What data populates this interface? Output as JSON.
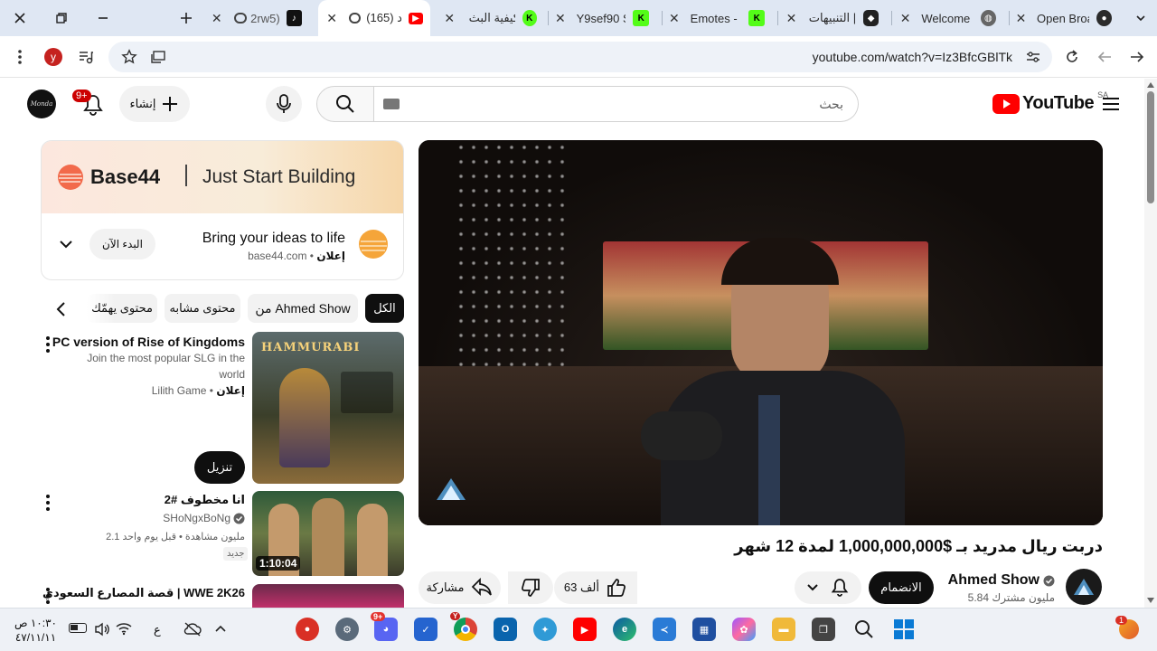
{
  "tabs": [
    {
      "title": "2rw5)",
      "favicon": "tiktok-icon"
    },
    {
      "title": "(165) ‏ د",
      "favicon": "youtube-icon",
      "active": true
    },
    {
      "title": "كيفية البث",
      "favicon": "kick-icon"
    },
    {
      "title": "Y9sef90 St",
      "favicon": "kick-icon"
    },
    {
      "title": "Emotes - K",
      "favicon": "kick-icon"
    },
    {
      "title": "التنبيهات |",
      "favicon": "streamelements-icon"
    },
    {
      "title": "Welcome",
      "favicon": "globe-icon"
    },
    {
      "title": "Open Broa",
      "favicon": "obs-icon"
    }
  ],
  "toolbar": {
    "url": "youtube.com/watch?v=Iz3BfcGBlTk",
    "profile_initial": "y"
  },
  "header": {
    "logo_text": "YouTube",
    "region": "SA",
    "search_placeholder": "بحث",
    "create_label": "إنشاء",
    "notifications_badge": "9+"
  },
  "ad": {
    "banner_brand": "Base44",
    "banner_tagline": "Just Start Building",
    "headline": "Bring your ideas to life",
    "sponsored_label": "إعلان",
    "domain": "base44.com",
    "cta": "البدء الآن"
  },
  "chips": [
    "الكل",
    "من Ahmed Show",
    "محتوى مشابه",
    "محتوى يهمّك"
  ],
  "recommendations": [
    {
      "title": "PC version of Rise of Kingdoms",
      "desc_line1": "Join the most popular SLG in the",
      "desc_line2": "world",
      "sponsored_label": "إعلان",
      "channel": "Lilith Game",
      "install_label": "تنزيل",
      "thumb_title": "HAMMURABI"
    },
    {
      "title": "انا مخطوف #2",
      "channel": "SHoNgxBoNg",
      "stats": "2.1 مليون مشاهدة • قبل يوم واحد",
      "badge": "جديد",
      "duration": "1:10:04"
    },
    {
      "title": "قصة المصارع السعودي | WWE 2K26"
    }
  ],
  "video": {
    "title": "دربت ريال مدريد بـ $1,000,000,000 لمدة 12 شهر",
    "channel": "Ahmed Show",
    "subscribers": "5.84 مليون مشترك",
    "join_label": "الانضمام",
    "likes": "63 ألف",
    "share_label": "مشاركة"
  },
  "taskbar": {
    "time": "١٠:٣٠ ص",
    "date": "٤٧/١١/١١",
    "lang": "ع",
    "discord_badge": "9+",
    "chrome_badge": "Y",
    "notif_badge": "1"
  },
  "colors": {
    "youtube_red": "#ff0000",
    "kick_green": "#53fc18",
    "tab_strip": "#dfe7f3"
  }
}
